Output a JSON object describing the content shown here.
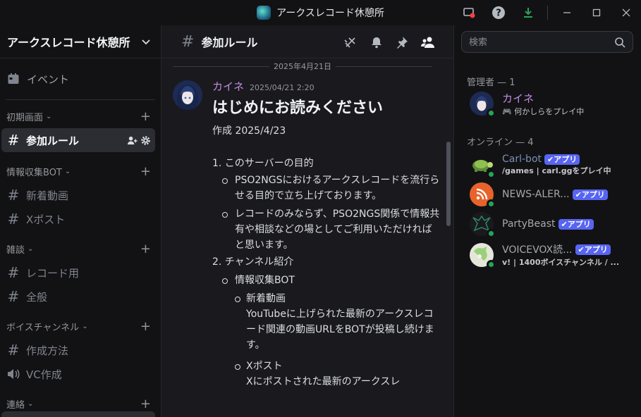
{
  "window": {
    "title": "アークスレコード休憩所"
  },
  "server": {
    "name": "アークスレコード休憩所"
  },
  "sidebar": {
    "event_label": "イベント",
    "categories": [
      {
        "name": "初期画面",
        "channels": [
          {
            "name": "参加ルール",
            "active": true
          }
        ]
      },
      {
        "name": "情報収集BOT",
        "channels": [
          {
            "name": "新着動画"
          },
          {
            "name": "Xポスト"
          }
        ]
      },
      {
        "name": "雑談",
        "channels": [
          {
            "name": "レコード用"
          },
          {
            "name": "全般"
          }
        ]
      },
      {
        "name": "ボイスチャンネル",
        "channels": [
          {
            "name": "作成方法"
          },
          {
            "name": "VC作成"
          }
        ]
      },
      {
        "name": "連絡",
        "channels": []
      }
    ]
  },
  "channel": {
    "name": "参加ルール"
  },
  "search": {
    "placeholder": "検索"
  },
  "messages": [
    {
      "date_divider": "2025年4月21日",
      "author": "カイネ",
      "timestamp": "2025/04/21 2:20",
      "heading": "はじめにお読みください",
      "created": "作成 2025/4/23",
      "sec1": "1. このサーバーの目的",
      "sec1_b1": "PSO2NGSにおけるアークスレコードを流行らせる目的で立ち上げております。",
      "sec1_b2": "レコードのみならず、PSO2NGS関係で情報共有や相談などの場としてご利用いただければと思います。",
      "sec2": "2. チャンネル紹介",
      "sec2_b1": "情報収集BOT",
      "sec2_b1a_title": "新着動画",
      "sec2_b1a_text": "YouTubeに上げられた最新のアークスレコード関連の動画URLをBOTが投稿し続けます。",
      "sec2_b1b_title": "Xポスト",
      "sec2_b1b_text": "Xにポストされた最新のアークスレ"
    }
  ],
  "members": {
    "admin_header": "管理者 — 1",
    "online_header": "オンライン — 4",
    "admins": [
      {
        "name": "カイネ",
        "activity": "何かしらをプレイ中",
        "color": "#c38be3"
      }
    ],
    "online": [
      {
        "name": "Carl-bot",
        "badge": "アプリ",
        "activity": "/games | carl.ggをプレイ中"
      },
      {
        "name": "NEWS-ALER...",
        "badge": "アプリ",
        "activity": ""
      },
      {
        "name": "PartyBeast",
        "badge": "アプリ",
        "activity": ""
      },
      {
        "name": "VOICEVOX読...",
        "badge": "アプリ",
        "activity": "v! | 1400ボイスチャンネル / ..."
      }
    ]
  }
}
